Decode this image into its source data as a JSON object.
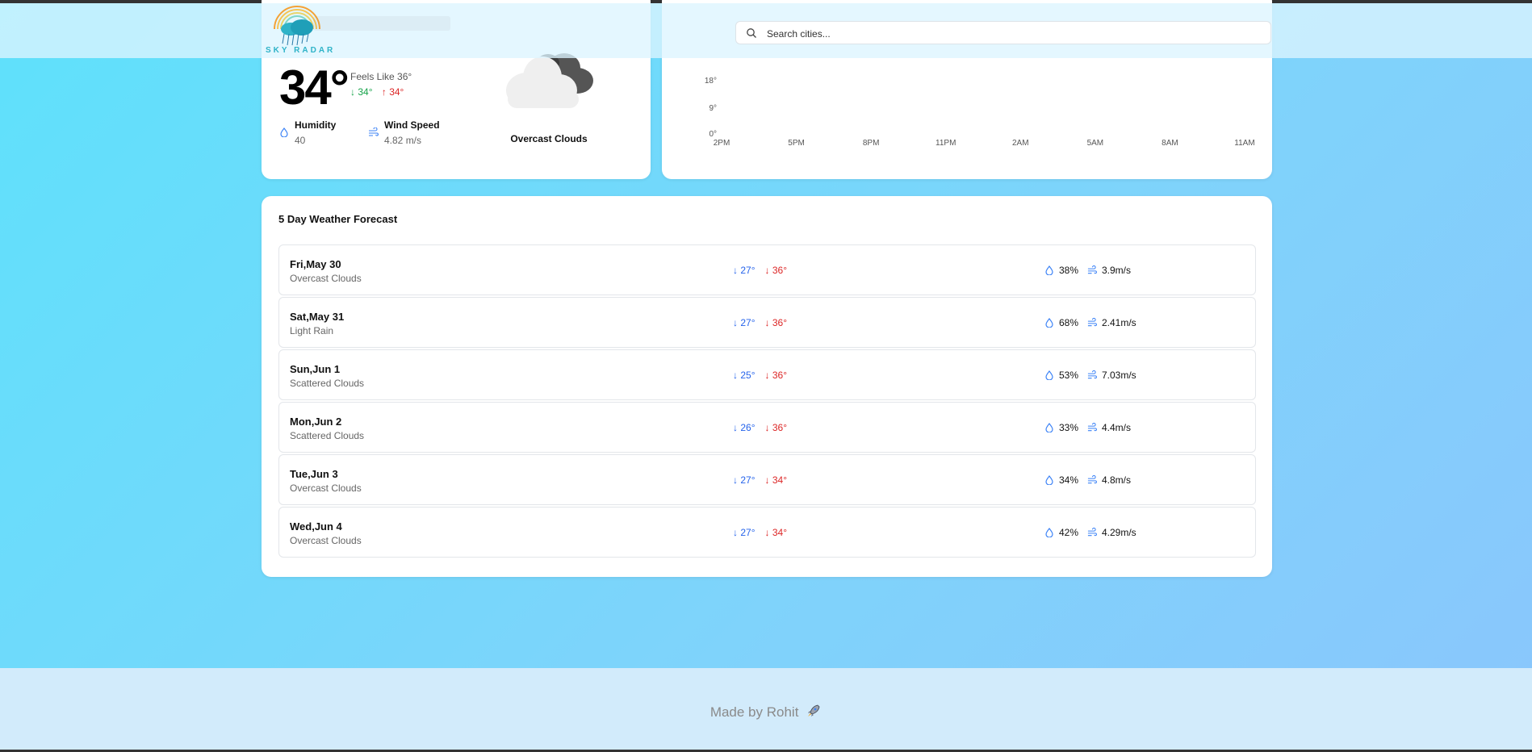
{
  "app": {
    "brand": "SKY RADAR"
  },
  "search": {
    "placeholder": "Search cities..."
  },
  "current": {
    "temp": "34°",
    "feels_like": "Feels Like 36°",
    "min": "34°",
    "max": "34°",
    "humidity_label": "Humidity",
    "humidity_value": "40",
    "wind_label": "Wind Speed",
    "wind_value": "4.82 m/s",
    "condition": "Overcast Clouds"
  },
  "chart_data": {
    "type": "line",
    "y_tick_labels": [
      "18°",
      "9°",
      "0°"
    ],
    "x_tick_labels": [
      "2PM",
      "5PM",
      "8PM",
      "11PM",
      "2AM",
      "5AM",
      "8AM",
      "11AM"
    ]
  },
  "forecast": {
    "title": "5 Day Weather Forecast",
    "days": [
      {
        "day": "Fri,May 30",
        "desc": "Overcast Clouds",
        "low": "27°",
        "high": "36°",
        "humidity": "38%",
        "wind": "3.9m/s"
      },
      {
        "day": "Sat,May 31",
        "desc": "Light Rain",
        "low": "27°",
        "high": "36°",
        "humidity": "68%",
        "wind": "2.41m/s"
      },
      {
        "day": "Sun,Jun 1",
        "desc": "Scattered Clouds",
        "low": "25°",
        "high": "36°",
        "humidity": "53%",
        "wind": "7.03m/s"
      },
      {
        "day": "Mon,Jun 2",
        "desc": "Scattered Clouds",
        "low": "26°",
        "high": "36°",
        "humidity": "33%",
        "wind": "4.4m/s"
      },
      {
        "day": "Tue,Jun 3",
        "desc": "Overcast Clouds",
        "low": "27°",
        "high": "34°",
        "humidity": "34%",
        "wind": "4.8m/s"
      },
      {
        "day": "Wed,Jun 4",
        "desc": "Overcast Clouds",
        "low": "27°",
        "high": "34°",
        "humidity": "42%",
        "wind": "4.29m/s"
      }
    ]
  },
  "footer": {
    "text": "Made by Rohit"
  },
  "icons": {
    "search": "search-icon",
    "humidity": "droplet-icon",
    "wind": "wind-icon",
    "down": "arrow-down-icon",
    "up": "arrow-up-icon",
    "weather": "cloud-icon",
    "footer": "rocket-icon"
  },
  "colors": {
    "low_temp": "#2563eb",
    "high_temp": "#dc2626",
    "min_temp_current": "#16a34a"
  }
}
